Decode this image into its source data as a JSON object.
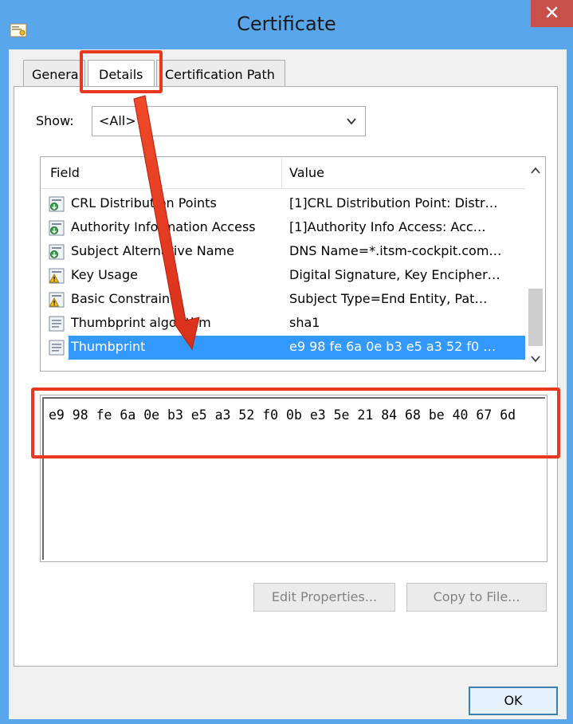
{
  "window": {
    "title": "Certificate",
    "close_glyph": "✕",
    "title_icon": "certificate-icon"
  },
  "tabs": [
    {
      "label": "General",
      "active": false
    },
    {
      "label": "Details",
      "active": true
    },
    {
      "label": "Certification Path",
      "active": false
    }
  ],
  "show": {
    "label": "Show:",
    "selected": "<All>"
  },
  "list": {
    "headers": {
      "field": "Field",
      "value": "Value"
    },
    "rows": [
      {
        "field": "CRL Distribution Points",
        "value": "[1]CRL Distribution Point: Distr…",
        "icon": "extension-icon"
      },
      {
        "field": "Authority Information Access",
        "value": "[1]Authority Info Access: Acc…",
        "icon": "extension-icon"
      },
      {
        "field": "Subject Alternative Name",
        "value": "DNS Name=*.itsm-cockpit.com…",
        "icon": "extension-icon"
      },
      {
        "field": "Key Usage",
        "value": "Digital Signature, Key Encipher…",
        "icon": "critical-extension-icon"
      },
      {
        "field": "Basic Constraints",
        "value": "Subject Type=End Entity, Pat…",
        "icon": "critical-extension-icon"
      },
      {
        "field": "Thumbprint algorithm",
        "value": "sha1",
        "icon": "property-icon"
      },
      {
        "field": "Thumbprint",
        "value": "e9 98 fe 6a 0e b3 e5 a3 52 f0 …",
        "icon": "property-icon",
        "selected": true
      }
    ]
  },
  "detail": {
    "text": "e9 98 fe 6a 0e b3 e5 a3 52 f0 0b e3 5e 21 84 68 be 40 67 6d"
  },
  "buttons": {
    "edit_properties": "Edit Properties...",
    "copy_to_file": "Copy to File...",
    "ok": "OK"
  },
  "colors": {
    "title_bar": "#5aa6ea",
    "close_button": "#c7504a",
    "selection": "#3399ff",
    "annotation_red": "#e8381f"
  }
}
